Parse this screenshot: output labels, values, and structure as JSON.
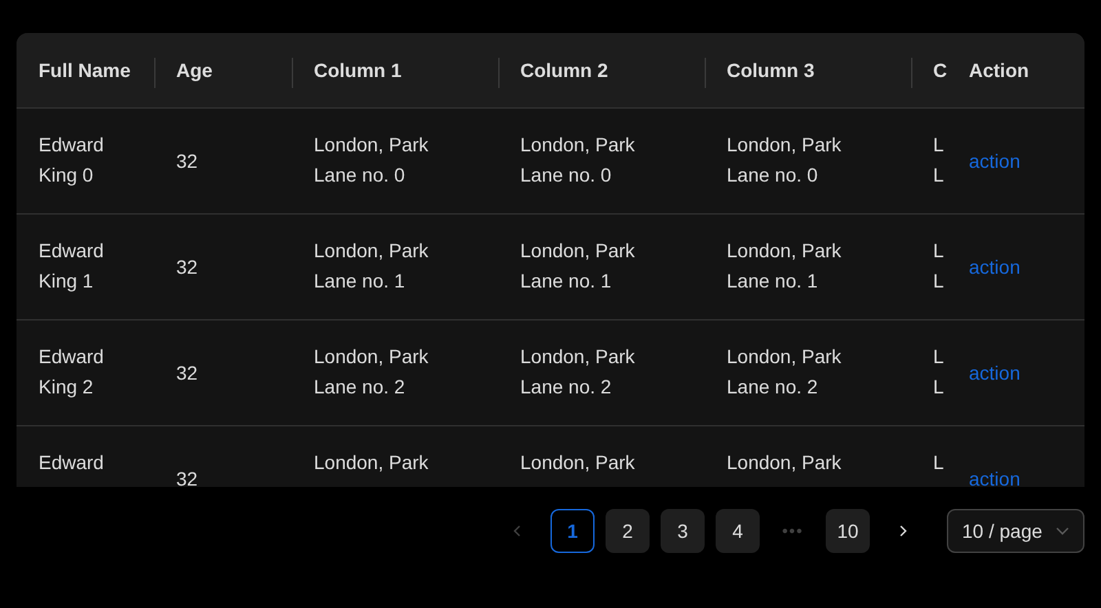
{
  "table": {
    "columns": [
      "Full Name",
      "Age",
      "Column 1",
      "Column 2",
      "Column 3",
      "C",
      "Action"
    ],
    "rows": [
      {
        "cells": [
          "Edward King 0",
          "32",
          "London, Park Lane no. 0",
          "London, Park Lane no. 0",
          "London, Park Lane no. 0",
          "L L",
          "action"
        ]
      },
      {
        "cells": [
          "Edward King 1",
          "32",
          "London, Park Lane no. 1",
          "London, Park Lane no. 1",
          "London, Park Lane no. 1",
          "L L",
          "action"
        ]
      },
      {
        "cells": [
          "Edward King 2",
          "32",
          "London, Park Lane no. 2",
          "London, Park Lane no. 2",
          "London, Park Lane no. 2",
          "L L",
          "action"
        ]
      },
      {
        "cells": [
          "Edward",
          "32",
          "London, Park",
          "London, Park",
          "London, Park",
          "L",
          "action"
        ]
      }
    ]
  },
  "pagination": {
    "prev_disabled": true,
    "next_disabled": false,
    "pages": [
      {
        "kind": "page",
        "label": "1",
        "selected": true
      },
      {
        "kind": "page",
        "label": "2",
        "selected": false
      },
      {
        "kind": "page",
        "label": "3",
        "selected": false
      },
      {
        "kind": "page",
        "label": "4",
        "selected": false
      },
      {
        "kind": "ellipsis",
        "label": "•••",
        "selected": false
      },
      {
        "kind": "page",
        "label": "10",
        "selected": false
      }
    ],
    "page_size": "10 / page"
  }
}
